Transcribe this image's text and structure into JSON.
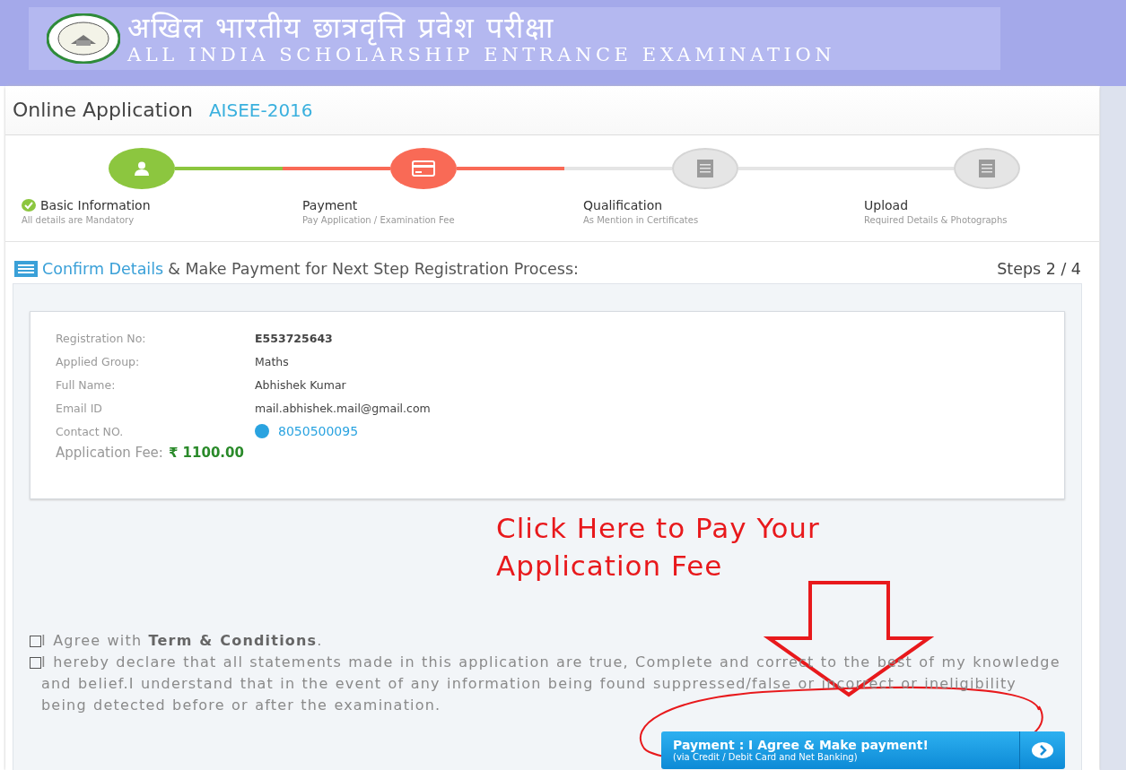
{
  "banner": {
    "title_hindi": "अखिल भारतीय छात्रवृत्ति प्रवेश परीक्षा",
    "title_english": "ALL INDIA SCHOLARSHIP ENTRANCE EXAMINATION"
  },
  "page": {
    "title": "Online Application",
    "code": "AISEE-2016"
  },
  "steps": [
    {
      "title": "Basic Information",
      "subtitle": "All details are Mandatory",
      "completed": true,
      "selected": false
    },
    {
      "title": "Payment",
      "subtitle": "Pay Application / Examination Fee",
      "completed": false,
      "selected": true
    },
    {
      "title": "Qualification",
      "subtitle": "As Mention in Certificates",
      "completed": false,
      "selected": false
    },
    {
      "title": "Upload",
      "subtitle": "Required Details & Photographs",
      "completed": false,
      "selected": false
    }
  ],
  "section": {
    "highlight": "Confirm Details",
    "rest": "& Make Payment for Next Step Registration Process:",
    "counter": "Steps 2 / 4"
  },
  "details": [
    {
      "label": "Registration No:",
      "value": "E553725643",
      "kind": "bold"
    },
    {
      "label": "Applied Group:",
      "value": "Maths",
      "kind": "text"
    },
    {
      "label": "Full Name:",
      "value": "Abhishek Kumar",
      "kind": "text"
    },
    {
      "label": "Email ID",
      "value": "mail.abhishek.mail@gmail.com",
      "kind": "text"
    },
    {
      "label": "Contact NO.",
      "value": "8050500095",
      "kind": "phone"
    }
  ],
  "fee": {
    "label": "Application Fee:",
    "amount": "₹ 1100.00"
  },
  "declarations": [
    {
      "text": "I Agree with **Term & Conditions**.",
      "checked": false
    },
    {
      "text": "I hereby declare that all statements made in this application are true, Complete and correct to the best of my knowledge and belief.I understand that in the event of any information being found suppressed/false or incorrect or ineligibility being detected before or after the examination.",
      "checked": false
    }
  ],
  "pay_button": {
    "label": "Payment : I Agree & Make payment!",
    "sublabel": "(via Credit / Debit Card and Net Banking)"
  },
  "annotation": {
    "lines": [
      "Click Here to Pay Your",
      "Application Fee"
    ]
  }
}
